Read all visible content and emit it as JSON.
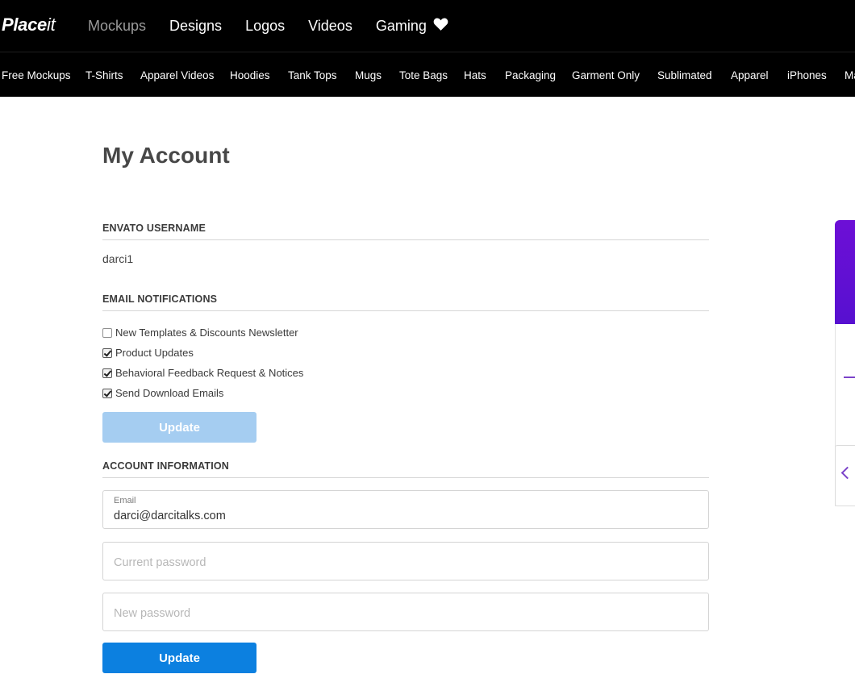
{
  "header": {
    "logo": {
      "bold": "Place",
      "light": "it"
    },
    "nav": [
      {
        "label": "Mockups",
        "active": true
      },
      {
        "label": "Designs"
      },
      {
        "label": "Logos"
      },
      {
        "label": "Videos"
      },
      {
        "label": "Gaming"
      }
    ],
    "favorites_icon": "heart-icon"
  },
  "subnav": [
    "Free Mockups",
    "T-Shirts",
    "Apparel Videos",
    "Hoodies",
    "Tank Tops",
    "Mugs",
    "Tote Bags",
    "Hats",
    "Packaging",
    "Garment Only",
    "Sublimated",
    "Apparel",
    "iPhones",
    "Ma"
  ],
  "page": {
    "title": "My Account"
  },
  "envato": {
    "heading": "ENVATO USERNAME",
    "username": "darci1"
  },
  "notifications": {
    "heading": "EMAIL NOTIFICATIONS",
    "options": [
      {
        "label": "New Templates & Discounts Newsletter",
        "checked": false
      },
      {
        "label": "Product Updates",
        "checked": true
      },
      {
        "label": "Behavioral Feedback Request & Notices",
        "checked": true
      },
      {
        "label": "Send Download Emails",
        "checked": true
      }
    ],
    "update_label": "Update"
  },
  "account": {
    "heading": "ACCOUNT INFORMATION",
    "email_label": "Email",
    "email_value": "darci@darcitalks.com",
    "current_password_placeholder": "Current password",
    "new_password_placeholder": "New password",
    "update_label": "Update"
  },
  "side_widget": {
    "accent": "#6d0fd6",
    "icon": "chevron-left-icon"
  },
  "colors": {
    "primary_button": "#0c80e0",
    "disabled_button": "#a5cdf1",
    "header_bg": "#000000"
  }
}
